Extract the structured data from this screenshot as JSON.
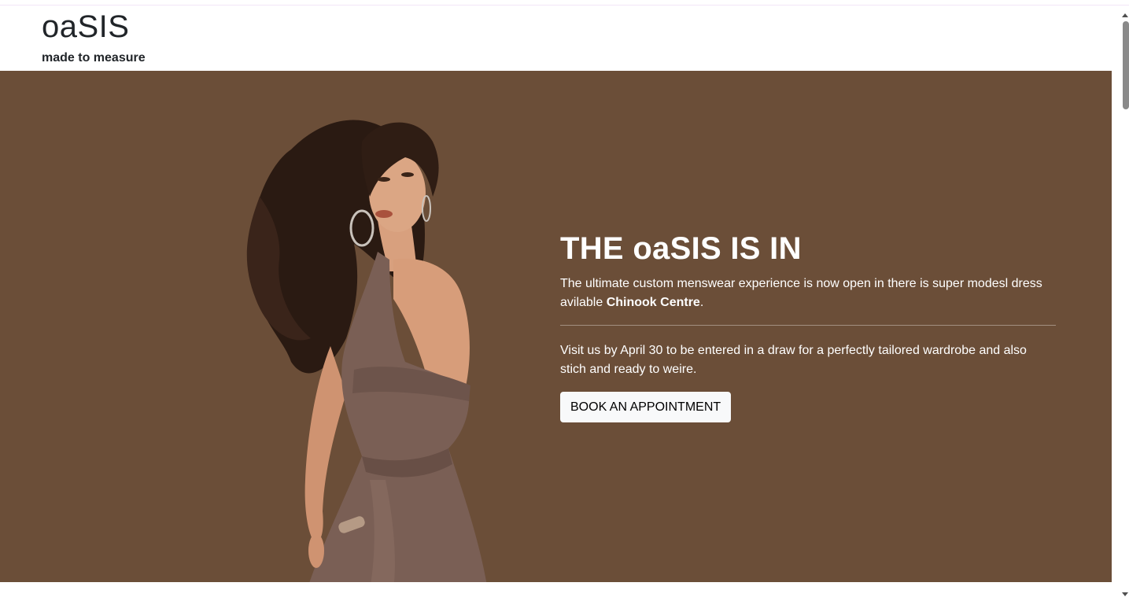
{
  "header": {
    "brand": "oaSIS",
    "tagline": "made to measure"
  },
  "hero": {
    "title": "THE oaSIS IS IN",
    "lead_text": "The ultimate custom menswear experience is now open in there is super modesl dress avilable ",
    "lead_strong": "Chinook Centre",
    "lead_end": ".",
    "visit_text": "Visit us by April 30 to be entered in a draw for a perfectly tailored wardrobe and also stich and ready to weire.",
    "button_label": "BOOK AN APPOINTMENT",
    "background_color": "#6b4e38",
    "image_icon": "model-in-brown-dress-image"
  }
}
